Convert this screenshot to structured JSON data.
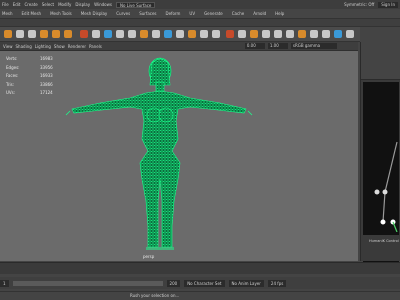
{
  "menubar": {
    "workspace": "Modeling",
    "live_surface": "No Live Surface",
    "symmetry": "Symmetric: Off",
    "signin": "Sign In"
  },
  "menus": [
    "File",
    "Edit",
    "Create",
    "Select",
    "Modify",
    "Display",
    "Windows",
    "Mesh",
    "Edit Mesh",
    "Mesh Tools",
    "Mesh Display",
    "Curves",
    "Surfaces",
    "Deform",
    "UV",
    "Generate",
    "Cache",
    "Arnold",
    "Help"
  ],
  "viewport": {
    "menus": [
      "View",
      "Shading",
      "Lighting",
      "Show",
      "Renderer",
      "Panels"
    ],
    "near": "0.00",
    "far": "1.00",
    "color_space": "sRGB gamma",
    "hud": [
      {
        "label": "Verts:",
        "value": "16983"
      },
      {
        "label": "Edges:",
        "value": "33956"
      },
      {
        "label": "Faces:",
        "value": "16933"
      },
      {
        "label": "Tris:",
        "value": "33866"
      },
      {
        "label": "UVs:",
        "value": "17124"
      }
    ],
    "camera": "persp",
    "model_color": "#19ff8c"
  },
  "right_panel": {
    "bottom_title": "HumanIK Control"
  },
  "range": {
    "start": "1",
    "end": "200",
    "character_set": "No Character Set",
    "anim_layer": "No Anim Layer",
    "fps": "24 fps"
  },
  "command": {
    "label": "Rush your selection on..."
  }
}
